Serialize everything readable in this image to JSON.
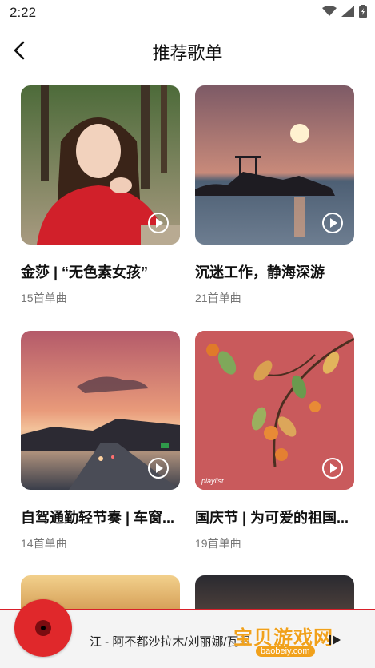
{
  "status_bar": {
    "time": "2:22"
  },
  "header": {
    "title": "推荐歌单"
  },
  "playlists": [
    {
      "name": "金莎 | “无色素女孩”",
      "count": "15首单曲"
    },
    {
      "name": "沉迷工作，静海深游",
      "count": "21首单曲"
    },
    {
      "name": "自驾通勤轻节奏 | 车窗...",
      "count": "14首单曲",
      "overlay": ""
    },
    {
      "name": "国庆节 | 为可爱的祖国...",
      "count": "19首单曲",
      "overlay": "playlist"
    }
  ],
  "player": {
    "now_playing": "江 - 阿不都沙拉木/刘丽娜/瓦里"
  },
  "watermark": {
    "title": "宝贝游戏网",
    "url": "baobeiy.com"
  },
  "colors": {
    "accent": "#d9202a",
    "watermark": "#f1a11b"
  }
}
